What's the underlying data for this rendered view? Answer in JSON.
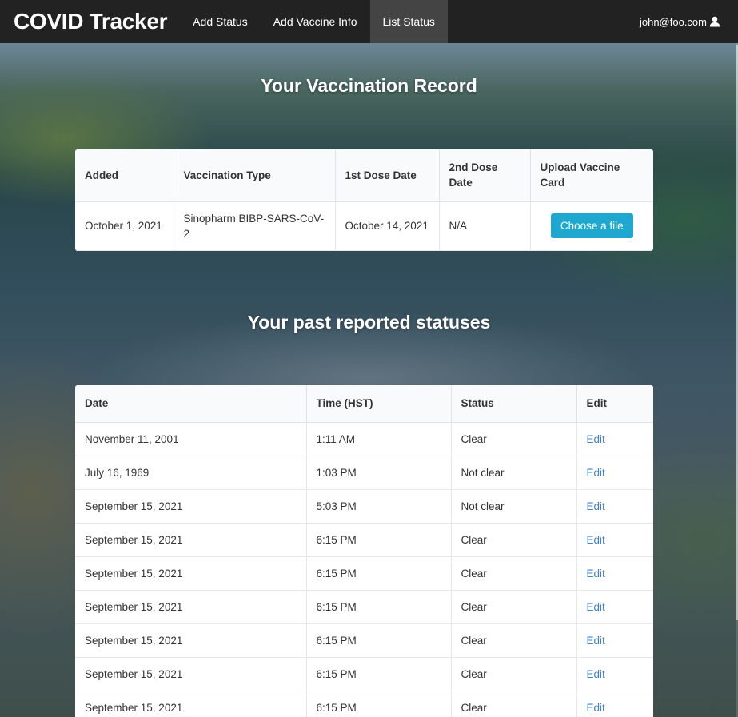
{
  "navbar": {
    "brand": "COVID Tracker",
    "items": [
      {
        "label": "Add Status"
      },
      {
        "label": "Add Vaccine Info"
      },
      {
        "label": "List Status"
      }
    ],
    "user": "john@foo.com",
    "user_icon": "user-icon"
  },
  "vaccination": {
    "title": "Your Vaccination Record",
    "headers": [
      "Added",
      "Vaccination Type",
      "1st Dose Date",
      "2nd Dose Date",
      "Upload Vaccine Card"
    ],
    "row": {
      "added": "October 1, 2021",
      "type": "Sinopharm BIBP-SARS-CoV-2",
      "dose1": "October 14, 2021",
      "dose2": "N/A",
      "upload_label": "Choose a file"
    }
  },
  "statuses": {
    "title": "Your past reported statuses",
    "headers": [
      "Date",
      "Time (HST)",
      "Status",
      "Edit"
    ],
    "rows": [
      {
        "date": "November 11, 2001",
        "time": "1:11 AM",
        "status": "Clear",
        "edit": "Edit"
      },
      {
        "date": "July 16, 1969",
        "time": "1:03 PM",
        "status": "Not clear",
        "edit": "Edit"
      },
      {
        "date": "September 15, 2021",
        "time": "5:03 PM",
        "status": "Not clear",
        "edit": "Edit"
      },
      {
        "date": "September 15, 2021",
        "time": "6:15 PM",
        "status": "Clear",
        "edit": "Edit"
      },
      {
        "date": "September 15, 2021",
        "time": "6:15 PM",
        "status": "Clear",
        "edit": "Edit"
      },
      {
        "date": "September 15, 2021",
        "time": "6:15 PM",
        "status": "Clear",
        "edit": "Edit"
      },
      {
        "date": "September 15, 2021",
        "time": "6:15 PM",
        "status": "Clear",
        "edit": "Edit"
      },
      {
        "date": "September 15, 2021",
        "time": "6:15 PM",
        "status": "Clear",
        "edit": "Edit"
      },
      {
        "date": "September 15, 2021",
        "time": "6:15 PM",
        "status": "Clear",
        "edit": "Edit"
      }
    ]
  },
  "colors": {
    "navbar": "#222222",
    "nav_active": "#444444",
    "button": "#1fa8cf",
    "link": "#4183c4"
  }
}
